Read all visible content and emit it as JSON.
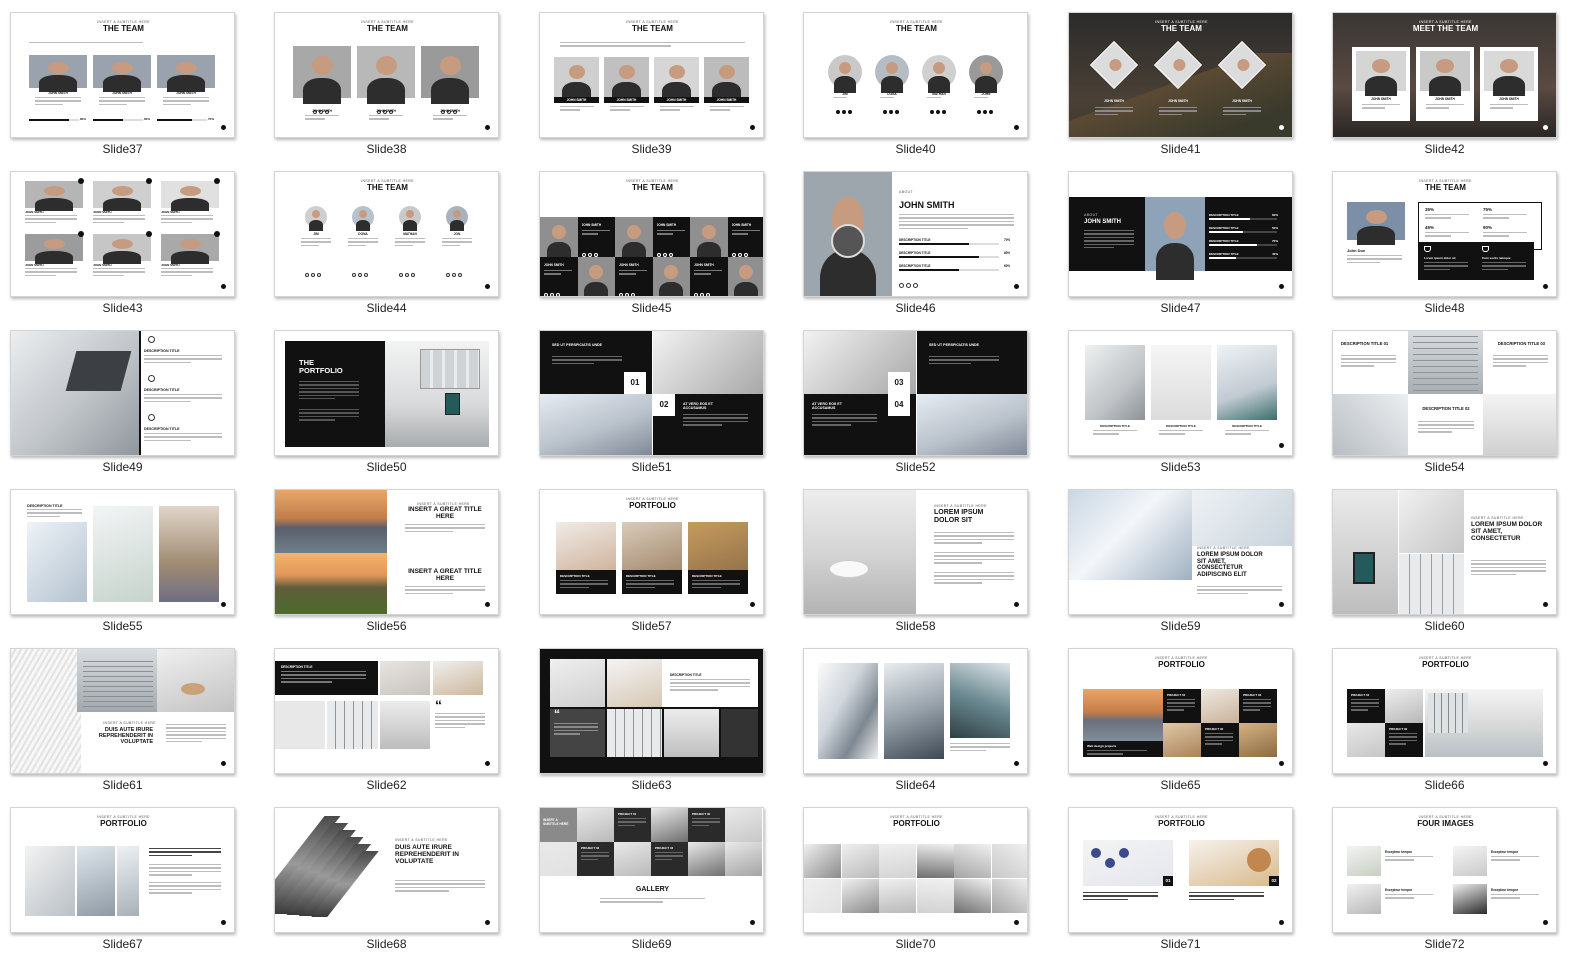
{
  "accent": "#111111",
  "slides": [
    {
      "label": "Slide37",
      "layout": "team-bars",
      "subtitle": "INSERT A SUBTITLE HERE",
      "title": "THE TEAM",
      "people": [
        {
          "name": "JOHN SMITH",
          "value": "80%"
        },
        {
          "name": "JOHN SMITH",
          "value": "60%"
        },
        {
          "name": "JOHN SMITH",
          "value": "70%"
        }
      ]
    },
    {
      "label": "Slide38",
      "layout": "team-3",
      "subtitle": "INSERT A SUBTITLE HERE",
      "title": "THE TEAM",
      "people": [
        {
          "name": "JOHN SMITH"
        },
        {
          "name": "JOHN SMITH"
        },
        {
          "name": "JOHN SMITH"
        }
      ]
    },
    {
      "label": "Slide39",
      "layout": "team-4",
      "subtitle": "INSERT A SUBTITLE HERE",
      "title": "THE TEAM",
      "people": [
        {
          "name": "JOHN SMITH"
        },
        {
          "name": "JOHN SMITH"
        },
        {
          "name": "JOHN SMITH"
        },
        {
          "name": "JOHN SMITH"
        }
      ]
    },
    {
      "label": "Slide40",
      "layout": "team-circles",
      "subtitle": "INSERT A SUBTITLE HERE",
      "title": "THE TEAM",
      "people": [
        {
          "name": "JIM"
        },
        {
          "name": "DONA"
        },
        {
          "name": "MATHAN"
        },
        {
          "name": "JOHN"
        }
      ]
    },
    {
      "label": "Slide41",
      "layout": "team-dark",
      "subtitle": "INSERT A SUBTITLE HERE",
      "title": "THE TEAM",
      "people": [
        {
          "name": "JOHN SMITH"
        },
        {
          "name": "JOHN SMITH"
        },
        {
          "name": "JOHN SMITH"
        }
      ]
    },
    {
      "label": "Slide42",
      "layout": "meet-team",
      "subtitle": "INSERT A SUBTITLE HERE",
      "title": "MEET THE TEAM",
      "people": [
        {
          "name": "JOHN SMITH"
        },
        {
          "name": "JOHN SMITH"
        },
        {
          "name": "JOHN SMITH"
        }
      ]
    },
    {
      "label": "Slide43",
      "layout": "team-grid6",
      "people": [
        {
          "name": "JOHN SMITH"
        },
        {
          "name": "JOHN SMITH"
        },
        {
          "name": "JOHN SMITH"
        },
        {
          "name": "JOHN SMITH"
        },
        {
          "name": "JOHN SMITH"
        },
        {
          "name": "JOHN SMITH"
        }
      ]
    },
    {
      "label": "Slide44",
      "layout": "team-small-circles",
      "subtitle": "INSERT A SUBTITLE HERE",
      "title": "THE TEAM",
      "people": [
        {
          "name": "JIM"
        },
        {
          "name": "DONA"
        },
        {
          "name": "MATHAN"
        },
        {
          "name": "JON"
        }
      ]
    },
    {
      "label": "Slide45",
      "layout": "team-checker",
      "subtitle": "INSERT A SUBTITLE HERE",
      "title": "THE TEAM",
      "people": [
        {
          "name": "JOHN SMITH"
        },
        {
          "name": "JOHN SMITH"
        },
        {
          "name": "JOHN SMITH"
        },
        {
          "name": "JOHN SMITH"
        },
        {
          "name": "JOHN SMITH"
        },
        {
          "name": "JOHN SMITH"
        }
      ]
    },
    {
      "label": "Slide46",
      "layout": "about",
      "subtitle": "ABOUT",
      "title": "JOHN SMITH",
      "rows": [
        {
          "name": "DESCRIPTION TITLE",
          "value": "70%"
        },
        {
          "name": "DESCRIPTION TITLE",
          "value": "80%"
        },
        {
          "name": "DESCRIPTION TITLE",
          "value": "60%"
        }
      ]
    },
    {
      "label": "Slide47",
      "layout": "about-dark",
      "subtitle": "ABOUT",
      "title": "JOHN SMITH",
      "rows": [
        {
          "name": "DESCRIPTION TITLE",
          "value": "60%"
        },
        {
          "name": "DESCRIPTION TITLE",
          "value": "50%"
        },
        {
          "name": "DESCRIPTION TITLE",
          "value": "70%"
        },
        {
          "name": "DESCRIPTION TITLE",
          "value": "40%"
        }
      ]
    },
    {
      "label": "Slide48",
      "layout": "team-stats",
      "subtitle": "INSERT A SUBTITLE HERE",
      "title": "THE TEAM",
      "name": "John Doe",
      "stats": [
        "35%",
        "75%",
        "45%",
        "90%"
      ],
      "boxes": [
        "Lorem ipsum dolor sit",
        "Cum sociis natoque"
      ]
    },
    {
      "label": "Slide49",
      "layout": "desc-list",
      "items": [
        "DESCRIPTION TITLE",
        "DESCRIPTION TITLE",
        "DESCRIPTION TITLE"
      ]
    },
    {
      "label": "Slide50",
      "layout": "portfolio-dark",
      "title": "THE PORTFOLIO"
    },
    {
      "label": "Slide51",
      "layout": "numbered",
      "heads": [
        "SED UT PERSPICIATIS UNDE",
        "AT VERO EOS ET ACCUSAMUS"
      ],
      "nums": [
        "01",
        "02"
      ]
    },
    {
      "label": "Slide52",
      "layout": "numbered-b",
      "heads": [
        "SED UT PERSPICIATIS UNDE",
        "AT VERO EOS ET ACCUSAMUS"
      ],
      "nums": [
        "03",
        "04"
      ]
    },
    {
      "label": "Slide53",
      "layout": "three-photos",
      "items": [
        "DESCRIPTION TITLE",
        "DESCRIPTION TITLE",
        "DESCRIPTION TITLE"
      ]
    },
    {
      "label": "Slide54",
      "layout": "desc-mosaic",
      "items": [
        "DESCRIPTION TITLE 01",
        "DESCRIPTION TITLE 03",
        "DESCRIPTION TITLE 02"
      ]
    },
    {
      "label": "Slide55",
      "layout": "stairs",
      "heading": "DESCRIPTION TITLE"
    },
    {
      "label": "Slide56",
      "layout": "landscapes",
      "subtitle": "INSERT A SUBTITLE HERE",
      "titles": [
        "INSERT A GREAT TITLE HERE",
        "INSERT A GREAT TITLE HERE"
      ]
    },
    {
      "label": "Slide57",
      "layout": "portfolio-3",
      "subtitle": "INSERT A SUBTITLE HERE",
      "title": "PORTFOLIO",
      "items": [
        "DESCRIPTION TITLE",
        "DESCRIPTION TITLE",
        "DESCRIPTION TITLE"
      ]
    },
    {
      "label": "Slide58",
      "layout": "lorem-right",
      "subtitle": "INSERT A SUBTITLE HERE",
      "title": "LOREM IPSUM DOLOR SIT"
    },
    {
      "label": "Slide59",
      "layout": "lorem-bottom",
      "subtitle": "INSERT A SUBTITLE HERE",
      "title": "LOREM IPSUM DOLOR SIT AMET, CONSECTETUR ADIPISCING ELIT"
    },
    {
      "label": "Slide60",
      "layout": "lorem-mosaic",
      "subtitle": "INSERT A SUBTITLE HERE",
      "title": "LOREM IPSUM DOLOR SIT AMET, CONSECTETUR"
    },
    {
      "label": "Slide61",
      "layout": "duis-left",
      "subtitle": "INSERT A SUBTITLE HERE",
      "title": "DUIS AUTE IRURE REPREHENDERIT IN VOLUPTATE"
    },
    {
      "label": "Slide62",
      "layout": "quote-light",
      "heading": "DESCRIPTION TITLE",
      "quote": "“"
    },
    {
      "label": "Slide63",
      "layout": "quote-dark",
      "heading": "DESCRIPTION TITLE",
      "quote": "“"
    },
    {
      "label": "Slide64",
      "layout": "arch-3",
      "heading": ""
    },
    {
      "label": "Slide65",
      "layout": "portfolio-projects",
      "subtitle": "INSERT A SUBTITLE HERE",
      "title": "PORTFOLIO",
      "projects": [
        "PROJECT 01",
        "PROJECT 02",
        "PROJECT 03"
      ],
      "caption": "Web design projects"
    },
    {
      "label": "Slide66",
      "layout": "portfolio-room",
      "subtitle": "INSERT A SUBTITLE HERE",
      "title": "PORTFOLIO",
      "projects": [
        "PROJECT 01",
        "PROJECT 02"
      ]
    },
    {
      "label": "Slide67",
      "layout": "portfolio-stairs",
      "subtitle": "INSERT A SUBTITLE HERE",
      "title": "PORTFOLIO"
    },
    {
      "label": "Slide68",
      "layout": "diagonal",
      "subtitle": "INSERT A SUBTITLE HERE",
      "title": "DUIS AUTE IRURE REPREHENDERIT IN VOLUPTATE"
    },
    {
      "label": "Slide69",
      "layout": "gallery",
      "subtitle": "INSERT A SUBTITLE HERE",
      "title": "GALLERY",
      "projects": [
        "PROJECT 01",
        "PROJECT 02",
        "PROJECT 03",
        "PROJECT 04"
      ]
    },
    {
      "label": "Slide70",
      "layout": "portfolio-grid",
      "subtitle": "INSERT A SUBTITLE HERE",
      "title": "PORTFOLIO"
    },
    {
      "label": "Slide71",
      "layout": "portfolio-two",
      "subtitle": "INSERT A SUBTITLE HERE",
      "title": "PORTFOLIO",
      "nums": [
        "01",
        "02"
      ]
    },
    {
      "label": "Slide72",
      "layout": "four-images",
      "subtitle": "INSERT A SUBTITLE HERE",
      "title": "FOUR IMAGES",
      "items": [
        "Excepteur tempor",
        "Excepteur tempor",
        "Excepteur tempor",
        "Excepteur tempor"
      ]
    }
  ]
}
